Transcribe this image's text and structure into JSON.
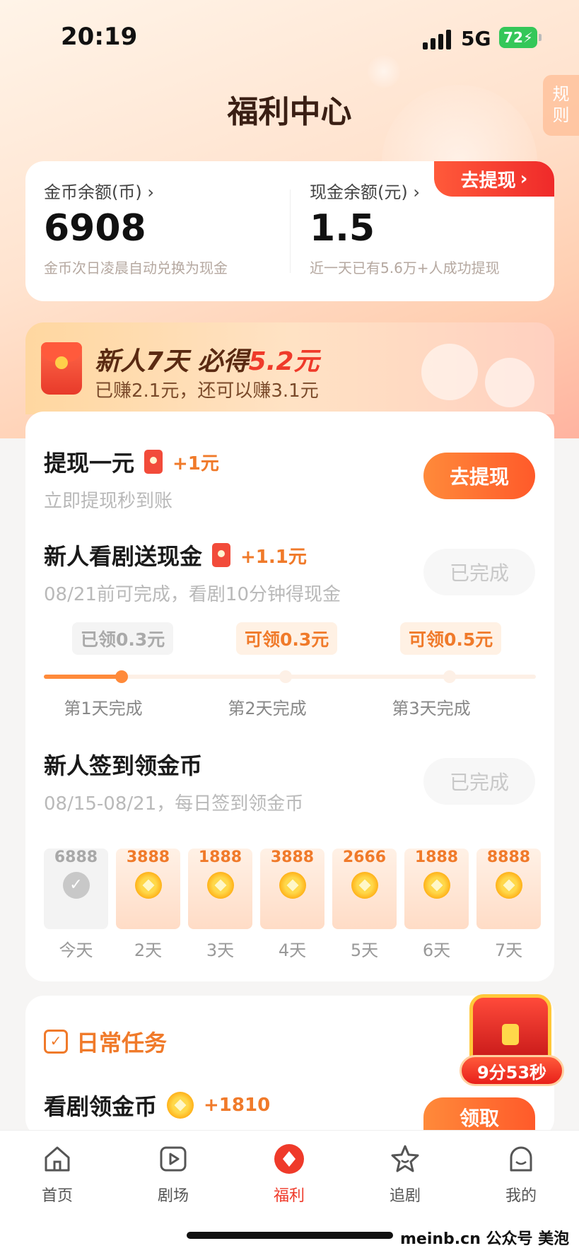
{
  "status": {
    "time": "20:19",
    "network": "5G",
    "battery": "72"
  },
  "page_title": "福利中心",
  "rules_tab": "规则",
  "balance": {
    "withdraw_tag": "去提现",
    "coin_label": "金币余额(币)",
    "coin_value": "6908",
    "coin_note": "金币次日凌晨自动兑换为现金",
    "cash_label": "现金余额(元)",
    "cash_value": "1.5",
    "cash_note": "近一天已有5.6万+人成功提现"
  },
  "newbie": {
    "title_prefix": "新人7天 必得",
    "title_amount": "5.2元",
    "subtitle": "已赚2.1元，还可以赚3.1元"
  },
  "tasks": {
    "withdraw": {
      "title": "提现一元",
      "reward": "+1元",
      "desc": "立即提现秒到账",
      "button": "去提现"
    },
    "watch": {
      "title": "新人看剧送现金",
      "reward": "+1.1元",
      "desc": "08/21前可完成，看剧10分钟得现金",
      "button": "已完成"
    },
    "watch_steps": [
      {
        "chip": "已领0.3元",
        "label": "第1天完成"
      },
      {
        "chip": "可领0.3元",
        "label": "第2天完成"
      },
      {
        "chip": "可领0.5元",
        "label": "第3天完成"
      }
    ],
    "watch_progress": 0.15,
    "signin": {
      "title": "新人签到领金币",
      "desc": "08/15-08/21，每日签到领金币",
      "button": "已完成"
    },
    "signin_days": [
      {
        "amount": "6888",
        "name": "今天",
        "claimed": true
      },
      {
        "amount": "3888",
        "name": "2天",
        "claimed": false
      },
      {
        "amount": "1888",
        "name": "3天",
        "claimed": false
      },
      {
        "amount": "3888",
        "name": "4天",
        "claimed": false
      },
      {
        "amount": "2666",
        "name": "5天",
        "claimed": false
      },
      {
        "amount": "1888",
        "name": "6天",
        "claimed": false
      },
      {
        "amount": "8888",
        "name": "7天",
        "claimed": false
      }
    ]
  },
  "daily": {
    "title": "日常任务",
    "watch_title": "看剧领金币",
    "watch_reward": "+1810",
    "watch_button": "领取"
  },
  "chest": {
    "timer": "9分53秒"
  },
  "tabbar": [
    {
      "label": "首页",
      "icon": "home-icon"
    },
    {
      "label": "剧场",
      "icon": "play-icon"
    },
    {
      "label": "福利",
      "icon": "welfare-icon"
    },
    {
      "label": "追剧",
      "icon": "star-icon"
    },
    {
      "label": "我的",
      "icon": "profile-icon"
    }
  ],
  "watermark": "meinb.cn  公众号 美泡君",
  "colors": {
    "accent": "#ff5a2a",
    "active_tab": "#ef3a2a",
    "reward": "#f07a2a"
  }
}
